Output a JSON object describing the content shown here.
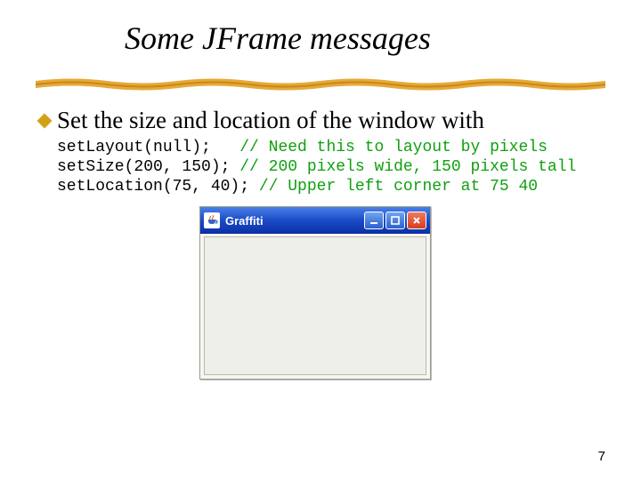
{
  "title": "Some JFrame messages",
  "bullet": "Set the size and location of the window with",
  "code": {
    "l1a": "setLayout(null);   ",
    "l1c": "// Need this to layout by pixels",
    "l2a": "setSize(200, 150); ",
    "l2c": "// 200 pixels wide, 150 pixels tall",
    "l3a": "setLocation(75, 40); ",
    "l3c": "// Upper left corner at 75 40"
  },
  "jframe": {
    "title": "Graffiti",
    "icons": {
      "app": "java-cup-icon",
      "min": "minimize-icon",
      "max": "maximize-icon",
      "close": "close-icon"
    }
  },
  "page_number": "7"
}
